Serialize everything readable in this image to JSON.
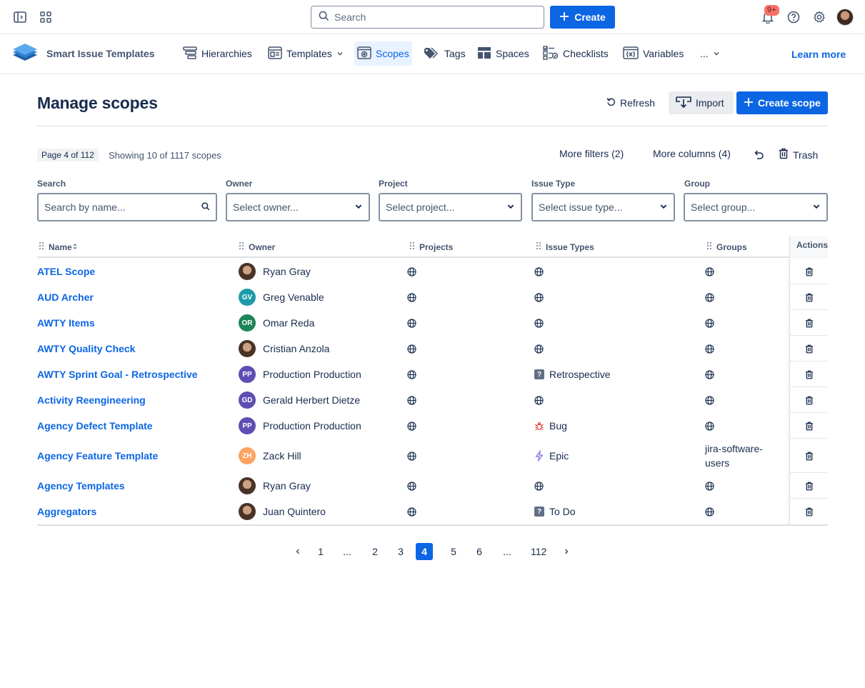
{
  "topbar": {
    "search_placeholder": "Search",
    "create_label": "Create",
    "notification_count": "9+"
  },
  "app": {
    "name": "Smart Issue Templates",
    "nav": [
      {
        "label": "Hierarchies",
        "icon": "hierarchy-icon"
      },
      {
        "label": "Templates",
        "icon": "template-icon",
        "dropdown": true
      },
      {
        "label": "Scopes",
        "icon": "scope-icon",
        "active": true
      },
      {
        "label": "Tags",
        "icon": "tag-icon"
      },
      {
        "label": "Spaces",
        "icon": "spaces-icon"
      },
      {
        "label": "Checklists",
        "icon": "checklist-icon"
      },
      {
        "label": "Variables",
        "icon": "variable-icon"
      },
      {
        "label": "...",
        "icon": "more-icon",
        "dropdown": true
      }
    ],
    "learn_more": "Learn more"
  },
  "page": {
    "title": "Manage scopes",
    "refresh_label": "Refresh",
    "import_label": "Import",
    "create_scope_label": "Create scope",
    "page_chip": "Page 4 of 112",
    "showing": "Showing 10 of 1117 scopes",
    "more_filters": "More filters (2)",
    "more_columns": "More columns (4)",
    "trash_label": "Trash"
  },
  "filters": {
    "search": {
      "label": "Search",
      "placeholder": "Search by name..."
    },
    "owner": {
      "label": "Owner",
      "placeholder": "Select owner..."
    },
    "project": {
      "label": "Project",
      "placeholder": "Select project..."
    },
    "issue_type": {
      "label": "Issue Type",
      "placeholder": "Select issue type..."
    },
    "group": {
      "label": "Group",
      "placeholder": "Select group..."
    }
  },
  "table": {
    "columns": {
      "name": "Name",
      "owner": "Owner",
      "projects": "Projects",
      "issue_types": "Issue Types",
      "groups": "Groups",
      "actions": "Actions"
    },
    "rows": [
      {
        "name": "ATEL Scope",
        "owner": "Ryan Gray",
        "owner_initials": "",
        "avatar_color": "",
        "projects": "all",
        "issue_type": "",
        "issue_type_icon": "globe-icon",
        "group": ""
      },
      {
        "name": "AUD Archer",
        "owner": "Greg Venable",
        "owner_initials": "GV",
        "avatar_color": "#1d9aaa",
        "projects": "all",
        "issue_type": "",
        "issue_type_icon": "globe-icon",
        "group": ""
      },
      {
        "name": "AWTY Items",
        "owner": "Omar Reda",
        "owner_initials": "OR",
        "avatar_color": "#1f845a",
        "projects": "all",
        "issue_type": "",
        "issue_type_icon": "globe-icon",
        "group": ""
      },
      {
        "name": "AWTY Quality Check",
        "owner": "Cristian Anzola",
        "owner_initials": "",
        "avatar_color": "",
        "projects": "all",
        "issue_type": "",
        "issue_type_icon": "globe-icon",
        "group": ""
      },
      {
        "name": "AWTY Sprint Goal - Retrospective",
        "owner": "Production Production",
        "owner_initials": "PP",
        "avatar_color": "#5e4db2",
        "projects": "all",
        "issue_type": "Retrospective",
        "issue_type_icon": "question-icon",
        "group": ""
      },
      {
        "name": "Activity Reengineering",
        "owner": "Gerald Herbert Dietze",
        "owner_initials": "GD",
        "avatar_color": "#5e4db2",
        "projects": "all",
        "issue_type": "",
        "issue_type_icon": "globe-icon",
        "group": ""
      },
      {
        "name": "Agency Defect Template",
        "owner": "Production Production",
        "owner_initials": "PP",
        "avatar_color": "#5e4db2",
        "projects": "all",
        "issue_type": "Bug",
        "issue_type_icon": "bug-icon",
        "group": ""
      },
      {
        "name": "Agency Feature Template",
        "owner": "Zack Hill",
        "owner_initials": "ZH",
        "avatar_color": "#fea362",
        "projects": "all",
        "issue_type": "Epic",
        "issue_type_icon": "epic-icon",
        "group": "jira-software-users"
      },
      {
        "name": "Agency Templates",
        "owner": "Ryan Gray",
        "owner_initials": "",
        "avatar_color": "",
        "projects": "all",
        "issue_type": "",
        "issue_type_icon": "globe-icon",
        "group": ""
      },
      {
        "name": "Aggregators",
        "owner": "Juan Quintero",
        "owner_initials": "",
        "avatar_color": "",
        "projects": "all",
        "issue_type": "To Do",
        "issue_type_icon": "question-icon",
        "group": ""
      }
    ]
  },
  "pagination": {
    "pages": [
      "1",
      "...",
      "2",
      "3",
      "4",
      "5",
      "6",
      "...",
      "112"
    ],
    "current": "4"
  },
  "colors": {
    "brand_blue": "#0c66e4",
    "text": "#172b4d",
    "subtle": "#44546f",
    "bug_red": "#e2483d",
    "epic_purple": "#8f7ee7",
    "question_gray": "#626f86"
  }
}
